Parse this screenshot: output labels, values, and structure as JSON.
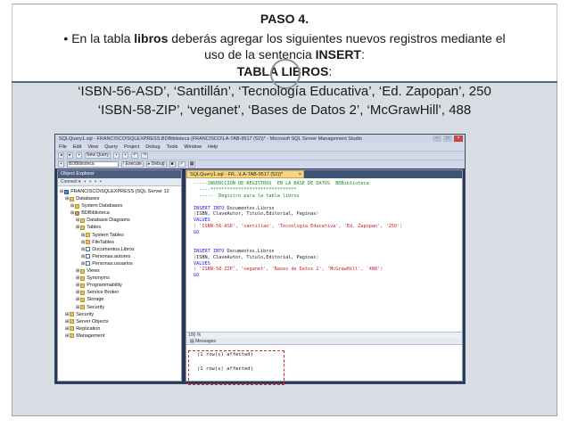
{
  "slide": {
    "step_title": "PASO 4.",
    "instruction_prefix": "• En la tabla ",
    "instruction_table": "libros",
    "instruction_mid": " deberás agregar los siguientes nuevos registros mediante el",
    "instruction_line2_prefix": "uso de la sentencia ",
    "instruction_keyword": "INSERT",
    "instruction_line2_suffix": ":",
    "table_heading": "TABLA LIBROS",
    "table_heading_suffix": ":",
    "record_1": "‘ISBN-56-ASD’, ‘Santillán’, ‘Tecnología Educativa’, ‘Ed. Zapopan’, 250",
    "record_2": "‘ISBN-58-ZIP’, ‘veganet’, ‘Bases de Datos 2’, ‘McGrawHill’, 488"
  },
  "ssms": {
    "window_title": "SQLQuery1.sql - FRANCISCO\\SQLEXPRESS.BDBiblioteca (FRANCISCO\\LA-TAB-9517 (52))* - Microsoft SQL Server Management Studio",
    "window_controls": [
      "–",
      "□",
      "×"
    ],
    "menu": [
      "File",
      "Edit",
      "View",
      "Query",
      "Project",
      "Debug",
      "Tools",
      "Window",
      "Help"
    ],
    "toolbar": {
      "new_query": "New Query",
      "database": "BDBiblioteca",
      "execute": "Execute",
      "debug": "Debug"
    },
    "object_explorer": {
      "title": "Object Explorer",
      "tools": [
        "Connect ▾",
        "▪",
        "▪",
        "▪",
        "▪"
      ],
      "tree": [
        {
          "label": "FRANCISCO\\SQLEXPRESS (SQL Server 12",
          "indent": 0,
          "icon": "server"
        },
        {
          "label": "Databases",
          "indent": 1,
          "icon": "folder"
        },
        {
          "label": "System Databases",
          "indent": 2,
          "icon": "folder"
        },
        {
          "label": "BDBiblioteca",
          "indent": 2,
          "icon": "db"
        },
        {
          "label": "Database Diagrams",
          "indent": 3,
          "icon": "folder"
        },
        {
          "label": "Tables",
          "indent": 3,
          "icon": "folder"
        },
        {
          "label": "System Tables",
          "indent": 4,
          "icon": "folder"
        },
        {
          "label": "FileTables",
          "indent": 4,
          "icon": "folder"
        },
        {
          "label": "Documentos.Libros",
          "indent": 4,
          "icon": "table"
        },
        {
          "label": "Personas.autores",
          "indent": 4,
          "icon": "table"
        },
        {
          "label": "Personas.usuarios",
          "indent": 4,
          "icon": "table"
        },
        {
          "label": "Views",
          "indent": 3,
          "icon": "folder"
        },
        {
          "label": "Synonyms",
          "indent": 3,
          "icon": "folder"
        },
        {
          "label": "Programmability",
          "indent": 3,
          "icon": "folder"
        },
        {
          "label": "Service Broker",
          "indent": 3,
          "icon": "folder"
        },
        {
          "label": "Storage",
          "indent": 3,
          "icon": "folder"
        },
        {
          "label": "Security",
          "indent": 3,
          "icon": "folder"
        },
        {
          "label": "Security",
          "indent": 1,
          "icon": "folder"
        },
        {
          "label": "Server Objects",
          "indent": 1,
          "icon": "folder"
        },
        {
          "label": "Replication",
          "indent": 1,
          "icon": "folder"
        },
        {
          "label": "Management",
          "indent": 1,
          "icon": "folder"
        }
      ]
    },
    "editor": {
      "tab_label": "SQLQuery1.sql - FR...\\LA-TAB-9517 (52))*",
      "zoom": "100 %",
      "messages_tab": "Messages",
      "messages": [
        "(1 row(s) affected)",
        "(1 row(s) affected)"
      ],
      "code": [
        [
          {
            "c": "cm",
            "t": "-----INSERCCION DE REGISTROS  EN LA BASE DE DATOS  BDBiblioteca"
          }
        ],
        [
          {
            "c": "cm",
            "t": "  ----*******************************"
          }
        ],
        [
          {
            "c": "cm",
            "t": "  -----  Registro para la tabla libros"
          }
        ],
        [
          {
            "c": "tx",
            "t": ""
          }
        ],
        [
          {
            "c": "kw",
            "t": "INSERT INTO "
          },
          {
            "c": "tx",
            "t": "Documentos.Libros"
          }
        ],
        [
          {
            "c": "gy",
            "t": "("
          },
          {
            "c": "tx",
            "t": "ISBN, ClaveAutor, Titulo,Editorial, Paginas"
          },
          {
            "c": "gy",
            "t": ")"
          }
        ],
        [
          {
            "c": "kw",
            "t": "VALUES"
          }
        ],
        [
          {
            "c": "gy",
            "t": "( "
          },
          {
            "c": "st",
            "t": "'ISBN-56-ASD', 'santillan', 'Tecnologia Educativa', 'Ed. Zapopan', '250'"
          },
          {
            "c": "gy",
            "t": ")"
          }
        ],
        [
          {
            "c": "kw",
            "t": "GO"
          }
        ],
        [
          {
            "c": "tx",
            "t": ""
          }
        ],
        [
          {
            "c": "tx",
            "t": ""
          }
        ],
        [
          {
            "c": "kw",
            "t": "INSERT INTO "
          },
          {
            "c": "tx",
            "t": "Documentos.Libros"
          }
        ],
        [
          {
            "c": "gy",
            "t": "("
          },
          {
            "c": "tx",
            "t": "ISBN, ClaveAutor, Titulo,Editorial, Paginas"
          },
          {
            "c": "gy",
            "t": ")"
          }
        ],
        [
          {
            "c": "kw",
            "t": "VALUES"
          }
        ],
        [
          {
            "c": "gy",
            "t": "( "
          },
          {
            "c": "st",
            "t": "'ISBN-58-ZIP', 'veganet', 'Bases de Datos 2', 'McGrawHill', '488'"
          },
          {
            "c": "gy",
            "t": ")"
          }
        ],
        [
          {
            "c": "kw",
            "t": "GO"
          }
        ]
      ]
    }
  }
}
